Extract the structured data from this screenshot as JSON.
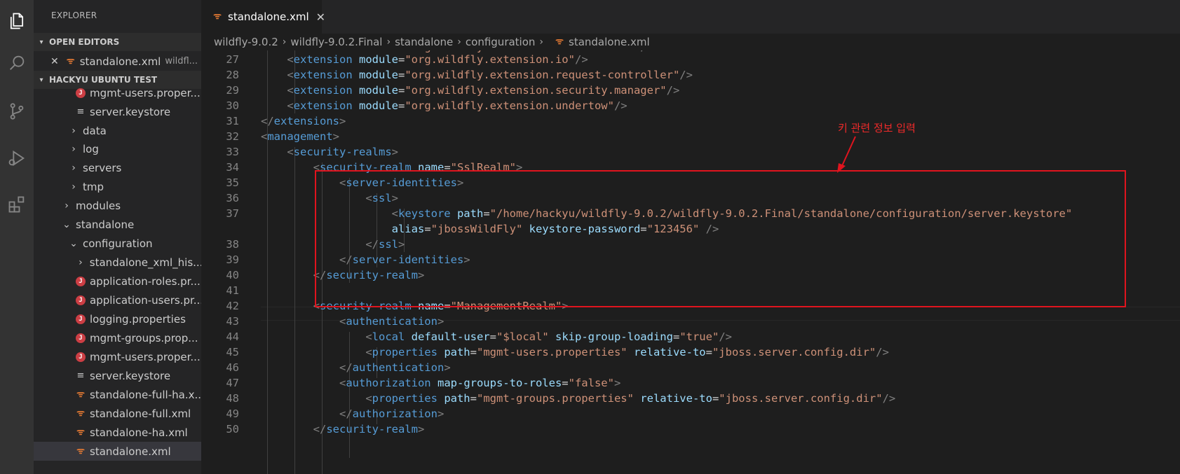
{
  "activity_bar": {
    "icons": [
      "files-icon",
      "search-icon",
      "source-control-icon",
      "debug-icon",
      "extensions-icon"
    ]
  },
  "sidebar": {
    "title": "EXPLORER",
    "open_editors": {
      "header": "OPEN EDITORS",
      "items": [
        {
          "name": "standalone.xml",
          "path": "wildfl..."
        }
      ]
    },
    "workspace": {
      "header": "HACKYU UBUNTU TEST",
      "items": [
        {
          "label": "mgmt-users.proper...",
          "icon": "java-props-icon"
        },
        {
          "label": "server.keystore",
          "icon": "text-file-icon"
        },
        {
          "label": "data",
          "icon": "chevron-right-icon"
        },
        {
          "label": "log",
          "icon": "chevron-right-icon"
        },
        {
          "label": "servers",
          "icon": "chevron-right-icon"
        },
        {
          "label": "tmp",
          "icon": "chevron-right-icon"
        },
        {
          "label": "modules",
          "icon": "chevron-right-icon"
        },
        {
          "label": "standalone",
          "icon": "chevron-down-icon"
        },
        {
          "label": "configuration",
          "icon": "chevron-down-icon"
        },
        {
          "label": "standalone_xml_his...",
          "icon": "chevron-right-icon"
        },
        {
          "label": "application-roles.pr...",
          "icon": "java-props-icon"
        },
        {
          "label": "application-users.pr...",
          "icon": "java-props-icon"
        },
        {
          "label": "logging.properties",
          "icon": "java-props-icon"
        },
        {
          "label": "mgmt-groups.prop...",
          "icon": "java-props-icon"
        },
        {
          "label": "mgmt-users.proper...",
          "icon": "java-props-icon"
        },
        {
          "label": "server.keystore",
          "icon": "text-file-icon"
        },
        {
          "label": "standalone-full-ha.x...",
          "icon": "xml-rss-icon"
        },
        {
          "label": "standalone-full.xml",
          "icon": "xml-rss-icon"
        },
        {
          "label": "standalone-ha.xml",
          "icon": "xml-rss-icon"
        },
        {
          "label": "standalone.xml",
          "icon": "xml-rss-icon"
        }
      ]
    }
  },
  "tab": {
    "label": "standalone.xml",
    "close": "✕"
  },
  "breadcrumb": [
    "wildfly-9.0.2",
    "wildfly-9.0.2.Final",
    "standalone",
    "configuration",
    "standalone.xml"
  ],
  "editor": {
    "line_numbers": [
      "27",
      "28",
      "29",
      "30",
      "31",
      "32",
      "33",
      "34",
      "35",
      "36",
      "37",
      "",
      "38",
      "39",
      "40",
      "41",
      "42",
      "43",
      "44",
      "45",
      "46",
      "47",
      "48",
      "49",
      "50"
    ]
  },
  "annotation": {
    "text": "키 관련 정보 입력",
    "color": "#e0141e"
  }
}
